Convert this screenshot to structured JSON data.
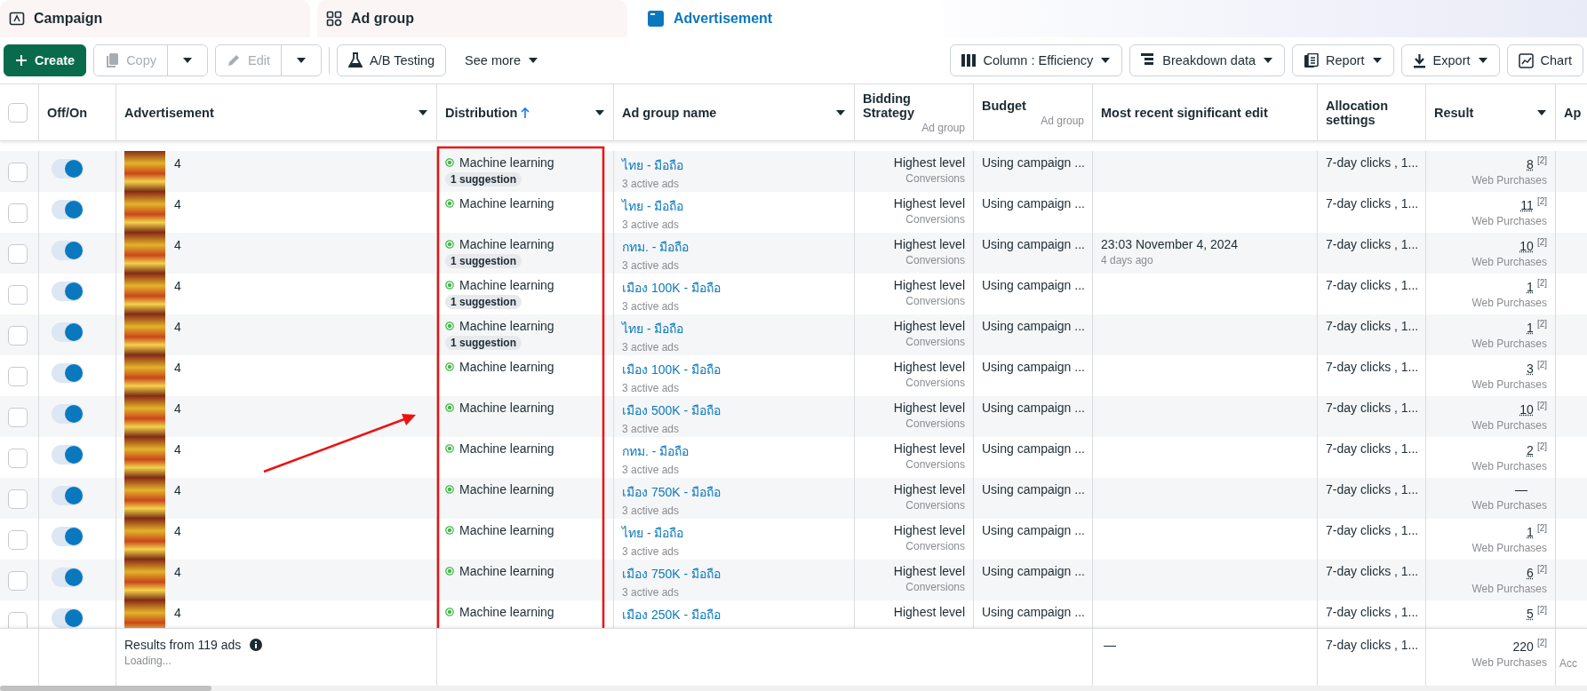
{
  "tabs": [
    {
      "label": "Campaign",
      "kind": "campaign",
      "selected": false
    },
    {
      "label": "Ad group",
      "kind": "adgroup",
      "selected": false
    },
    {
      "label": "Advertisement",
      "kind": "ad",
      "selected": true
    }
  ],
  "toolbar": {
    "left": [
      {
        "label": "Create",
        "kind": "create",
        "disabled": false,
        "split": false
      },
      {
        "label": "Copy",
        "kind": "copy",
        "disabled": true,
        "split": true
      },
      {
        "label": "Edit",
        "kind": "edit",
        "disabled": true,
        "split": true
      },
      {
        "label": "A/B Testing",
        "kind": "ab",
        "disabled": false,
        "split": false
      },
      {
        "label": "See more",
        "kind": "more",
        "disabled": false,
        "split": false
      }
    ],
    "right": [
      {
        "label": "Column : Efficiency",
        "kind": "column",
        "caret": true
      },
      {
        "label": "Breakdown data",
        "kind": "breakdown",
        "caret": true
      },
      {
        "label": "Report",
        "kind": "report",
        "caret": true
      },
      {
        "label": "Export",
        "kind": "export",
        "caret": true
      },
      {
        "label": "Chart",
        "kind": "chart",
        "caret": false
      }
    ]
  },
  "table": {
    "columns": [
      {
        "label": "Off/On",
        "menu": false,
        "sorted": false
      },
      {
        "label": "Advertisement",
        "menu": true,
        "sorted": false
      },
      {
        "label": "Distribution",
        "menu": true,
        "sorted": true
      },
      {
        "label": "Ad group name",
        "menu": true,
        "sorted": false
      },
      {
        "label": "Bidding Strategy",
        "sub": "Ad group",
        "menu": false,
        "sorted": false
      },
      {
        "label": "Budget",
        "sub": "Ad group",
        "menu": false,
        "sorted": false
      },
      {
        "label": "Most recent significant edit",
        "menu": false,
        "sorted": false
      },
      {
        "label": "Allocation settings",
        "menu": false,
        "sorted": false
      },
      {
        "label": "Result",
        "menu": true,
        "sorted": false
      },
      {
        "label": "Ap",
        "menu": false,
        "sorted": false
      }
    ],
    "select_all_checked": false,
    "rows": [
      {
        "checked": false,
        "on": true,
        "name": "4",
        "delivery": "Machine learning",
        "suggestion": "1 suggestion",
        "adgroup": "ไทย - มือถือ",
        "adgroup_sub": "3 active ads",
        "bid": "Highest level",
        "bid_sub": "Conversions",
        "budget": "Using campaign ...",
        "allocation": "7-day clicks , 1...",
        "result": "8",
        "result_note": "[2]",
        "result_sub": "Web Purchases"
      },
      {
        "checked": false,
        "on": true,
        "name": "4",
        "delivery": "Machine learning",
        "adgroup": "ไทย - มือถือ",
        "adgroup_sub": "3 active ads",
        "bid": "Highest level",
        "bid_sub": "Conversions",
        "budget": "Using campaign ...",
        "allocation": "7-day clicks , 1...",
        "result": "11",
        "result_note": "[2]",
        "result_sub": "Web Purchases"
      },
      {
        "checked": false,
        "on": true,
        "name": "4",
        "delivery": "Machine learning",
        "suggestion": "1 suggestion",
        "adgroup": "กทม. - มือถือ",
        "adgroup_sub": "3 active ads",
        "bid": "Highest level",
        "bid_sub": "Conversions",
        "budget": "Using campaign ...",
        "edit": "23:03 November 4, 2024",
        "edit_sub": "4 days ago",
        "allocation": "7-day clicks , 1...",
        "result": "10",
        "result_note": "[2]",
        "result_sub": "Web Purchases"
      },
      {
        "checked": false,
        "on": true,
        "name": "4",
        "delivery": "Machine learning",
        "suggestion": "1 suggestion",
        "adgroup": "เมือง 100K - มือถือ",
        "adgroup_sub": "3 active ads",
        "bid": "Highest level",
        "bid_sub": "Conversions",
        "budget": "Using campaign ...",
        "allocation": "7-day clicks , 1...",
        "result": "1",
        "result_note": "[2]",
        "result_sub": "Web Purchases"
      },
      {
        "checked": false,
        "on": true,
        "name": "4",
        "delivery": "Machine learning",
        "suggestion": "1 suggestion",
        "adgroup": "ไทย - มือถือ",
        "adgroup_sub": "3 active ads",
        "bid": "Highest level",
        "bid_sub": "Conversions",
        "budget": "Using campaign ...",
        "allocation": "7-day clicks , 1...",
        "result": "1",
        "result_note": "[2]",
        "result_sub": "Web Purchases"
      },
      {
        "checked": false,
        "on": true,
        "name": "4",
        "delivery": "Machine learning",
        "adgroup": "เมือง 100K - มือถือ",
        "adgroup_sub": "3 active ads",
        "bid": "Highest level",
        "bid_sub": "Conversions",
        "budget": "Using campaign ...",
        "allocation": "7-day clicks , 1...",
        "result": "3",
        "result_note": "[2]",
        "result_sub": "Web Purchases"
      },
      {
        "checked": false,
        "on": true,
        "name": "4",
        "delivery": "Machine learning",
        "adgroup": "เมือง 500K - มือถือ",
        "adgroup_sub": "3 active ads",
        "bid": "Highest level",
        "bid_sub": "Conversions",
        "budget": "Using campaign ...",
        "allocation": "7-day clicks , 1...",
        "result": "10",
        "result_note": "[2]",
        "result_sub": "Web Purchases"
      },
      {
        "checked": false,
        "on": true,
        "name": "4",
        "delivery": "Machine learning",
        "adgroup": "กทม. - มือถือ",
        "adgroup_sub": "3 active ads",
        "bid": "Highest level",
        "bid_sub": "Conversions",
        "budget": "Using campaign ...",
        "allocation": "7-day clicks , 1...",
        "result": "2",
        "result_note": "[2]",
        "result_sub": "Web Purchases"
      },
      {
        "checked": false,
        "on": true,
        "name": "4",
        "delivery": "Machine learning",
        "adgroup": "เมือง 750K - มือถือ",
        "adgroup_sub": "3 active ads",
        "bid": "Highest level",
        "bid_sub": "Conversions",
        "budget": "Using campaign ...",
        "allocation": "7-day clicks , 1...",
        "result": "—",
        "result_sub": "Web Purchases"
      },
      {
        "checked": false,
        "on": true,
        "name": "4",
        "delivery": "Machine learning",
        "adgroup": "ไทย - มือถือ",
        "adgroup_sub": "3 active ads",
        "bid": "Highest level",
        "bid_sub": "Conversions",
        "budget": "Using campaign ...",
        "allocation": "7-day clicks , 1...",
        "result": "1",
        "result_note": "[2]",
        "result_sub": "Web Purchases"
      },
      {
        "checked": false,
        "on": true,
        "name": "4",
        "delivery": "Machine learning",
        "adgroup": "เมือง 750K - มือถือ",
        "adgroup_sub": "3 active ads",
        "bid": "Highest level",
        "bid_sub": "Conversions",
        "budget": "Using campaign ...",
        "allocation": "7-day clicks , 1...",
        "result": "6",
        "result_note": "[2]",
        "result_sub": "Web Purchases"
      },
      {
        "checked": false,
        "on": true,
        "name": "4",
        "delivery": "Machine learning",
        "adgroup": "เมือง 250K - มือถือ",
        "bid": "Highest level",
        "budget": "Using campaign ...",
        "allocation": "7-day clicks , 1...",
        "result": "5",
        "result_note": "[2]"
      }
    ],
    "footer": {
      "summary": "Results from 119 ads",
      "status": "Loading...",
      "edit": "—",
      "allocation": "7-day clicks , 1...",
      "result": "220",
      "result_note": "[2]",
      "result_sub": "Web Purchases",
      "last": "Acc"
    }
  }
}
